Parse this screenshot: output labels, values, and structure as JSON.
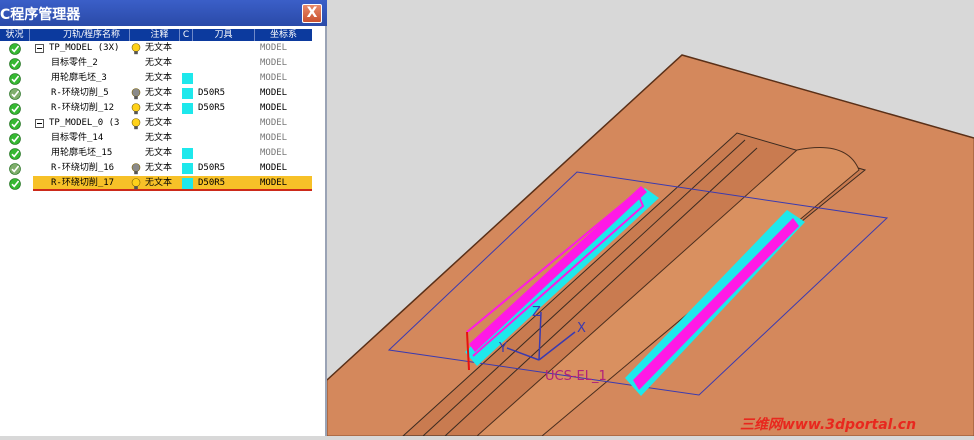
{
  "window": {
    "title": "C程序管理器",
    "close_label": "X"
  },
  "columns": [
    "状况",
    "刀轨/程序名称",
    "注释",
    "C",
    "刀具",
    "坐标系"
  ],
  "rows": [
    {
      "status": "ok",
      "expand": true,
      "name": "TP_MODEL (3X)",
      "bulb": "yellow",
      "note": "无文本",
      "swatch": false,
      "tool": "",
      "coord": "MODEL",
      "coord_dim": true,
      "selected": false
    },
    {
      "status": "ok",
      "expand": false,
      "name": "目标零件_2",
      "bulb": "",
      "note": "无文本",
      "swatch": false,
      "tool": "",
      "coord": "MODEL",
      "coord_dim": true,
      "selected": false
    },
    {
      "status": "ok",
      "expand": false,
      "name": "用轮廓毛坯_3",
      "bulb": "",
      "note": "无文本",
      "swatch": true,
      "tool": "",
      "coord": "MODEL",
      "coord_dim": true,
      "selected": false
    },
    {
      "status": "ok-grey",
      "expand": false,
      "name": "R-环绕切削_5",
      "bulb": "grey",
      "note": "无文本",
      "swatch": true,
      "tool": "D50R5",
      "coord": "MODEL",
      "coord_dim": false,
      "selected": false
    },
    {
      "status": "ok",
      "expand": false,
      "name": "R-环绕切削_12",
      "bulb": "yellow",
      "note": "无文本",
      "swatch": true,
      "tool": "D50R5",
      "coord": "MODEL",
      "coord_dim": false,
      "selected": false
    },
    {
      "status": "ok",
      "expand": true,
      "name": "TP_MODEL_0 (3",
      "bulb": "yellow",
      "note": "无文本",
      "swatch": false,
      "tool": "",
      "coord": "MODEL",
      "coord_dim": true,
      "selected": false
    },
    {
      "status": "ok",
      "expand": false,
      "name": "目标零件_14",
      "bulb": "",
      "note": "无文本",
      "swatch": false,
      "tool": "",
      "coord": "MODEL",
      "coord_dim": true,
      "selected": false
    },
    {
      "status": "ok",
      "expand": false,
      "name": "用轮廓毛坯_15",
      "bulb": "",
      "note": "无文本",
      "swatch": true,
      "tool": "",
      "coord": "MODEL",
      "coord_dim": true,
      "selected": false
    },
    {
      "status": "ok-grey",
      "expand": false,
      "name": "R-环绕切削_16",
      "bulb": "grey",
      "note": "无文本",
      "swatch": true,
      "tool": "D50R5",
      "coord": "MODEL",
      "coord_dim": false,
      "selected": false
    },
    {
      "status": "ok",
      "expand": false,
      "name": "R-环绕切削_17",
      "bulb": "yellow",
      "note": "无文本",
      "swatch": true,
      "tool": "D50R5",
      "coord": "MODEL",
      "coord_dim": false,
      "selected": true
    }
  ],
  "viewport": {
    "axis_x": "X",
    "axis_y": "Y",
    "axis_z": "Z",
    "csys_label": "UCS-EL_1",
    "colors": {
      "background": "#d8d8d8",
      "part": "#d4885c",
      "toolpath_cyan": "#1ee8ec",
      "toolpath_magenta": "#ff19e6",
      "outline": "#3a3ab0"
    }
  },
  "watermark": "三维网www.3dportal.cn"
}
